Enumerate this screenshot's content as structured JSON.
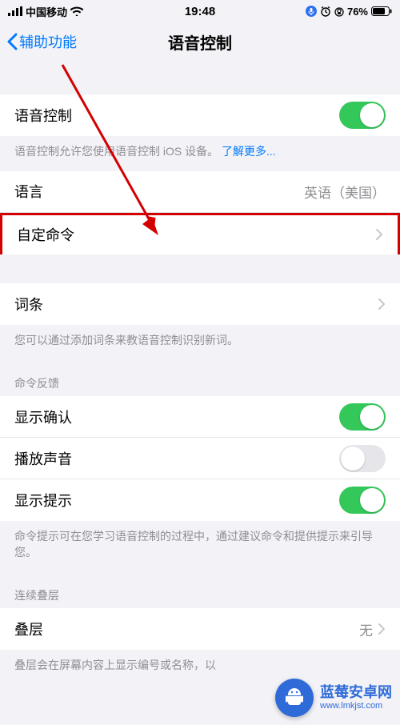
{
  "statusbar": {
    "carrier": "中国移动",
    "time": "19:48",
    "battery": "76%"
  },
  "nav": {
    "back_label": "辅助功能",
    "title": "语音控制"
  },
  "rows": {
    "voice_control_label": "语音控制",
    "voice_control_note_prefix": "语音控制允许您使用语音控制 iOS 设备。",
    "voice_control_note_link": "了解更多...",
    "language_label": "语言",
    "language_value": "英语（美国）",
    "custom_commands_label": "自定命令",
    "vocab_label": "词条",
    "vocab_note": "您可以通过添加词条来教语音控制识别新词。",
    "feedback_header": "命令反馈",
    "show_confirm_label": "显示确认",
    "play_sound_label": "播放声音",
    "show_hints_label": "显示提示",
    "hints_note": "命令提示可在您学习语音控制的过程中，通过建议命令和提供提示来引导您。",
    "overlay_header": "连续叠层",
    "overlay_label": "叠层",
    "overlay_value": "无",
    "overlay_note": "叠层会在屏幕内容上显示编号或名称，以"
  },
  "badge": {
    "title": "蓝莓安卓网",
    "url": "www.lmkjst.com"
  }
}
